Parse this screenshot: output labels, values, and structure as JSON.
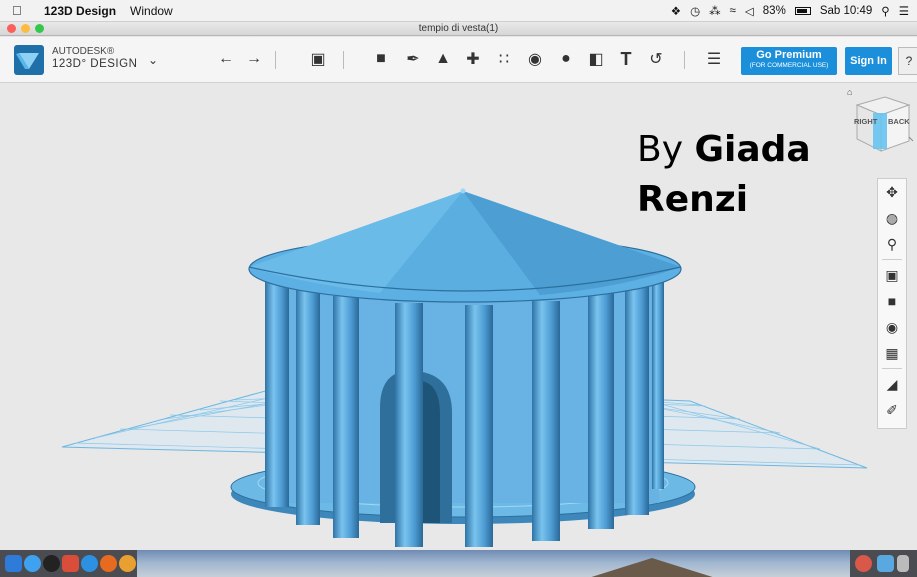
{
  "menubar": {
    "app_name": "123D Design",
    "menu_window": "Window",
    "battery": "83%",
    "clock": "Sab 10:49"
  },
  "window": {
    "title": "tempio di vesta(1)"
  },
  "toolbar": {
    "brand_line1": "AUTODESK®",
    "brand_line2": "123D° DESIGN",
    "premium_label": "Go Premium",
    "premium_sublabel": "(FOR COMMERCIAL USE)",
    "signin_label": "Sign In",
    "help_label": "?",
    "text_tool_label": "T",
    "icons": [
      "undo-icon",
      "redo-icon",
      "transform-icon",
      "primitives-icon",
      "sketch-icon",
      "construct-icon",
      "modify-icon",
      "pattern-icon",
      "group-icon",
      "combine-icon",
      "measure-icon",
      "text-icon",
      "snap-icon",
      "materials-icon"
    ]
  },
  "viewport": {
    "caption_prefix": "By",
    "caption_name_line1": "Giada",
    "caption_name_line2": "Renzi",
    "viewcube_right": "RIGHT",
    "viewcube_back": "BACK"
  },
  "navbar": {
    "icons": [
      "pan-icon",
      "orbit-icon",
      "zoom-icon",
      "fit-icon",
      "view-icon",
      "visibility-icon",
      "grid-icon",
      "material-view-icon",
      "edit-icon"
    ]
  },
  "colors": {
    "accent": "#1b8fd9",
    "model": "#5aaee0",
    "grid": "#8cc8ea"
  }
}
